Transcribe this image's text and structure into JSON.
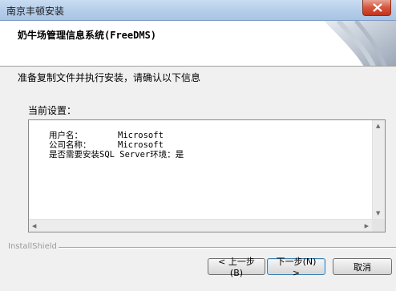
{
  "window": {
    "title": "南京丰顿安装"
  },
  "banner": {
    "title": "奶牛场管理信息系统(FreeDMS)"
  },
  "body": {
    "instruction": "准备复制文件并执行安装，请确认以下信息",
    "current_settings_label": "当前设置：",
    "settings": [
      {
        "key": "用户名：",
        "value": "Microsoft"
      },
      {
        "key": "公司名称：",
        "value": "Microsoft"
      },
      {
        "key": "是否需要安装SQL Server环境：",
        "value": "是"
      }
    ]
  },
  "footer": {
    "brand": "InstallShield",
    "back_label": "< 上一步(B)",
    "next_label": "下一步(N) >",
    "cancel_label": "取消"
  },
  "colors": {
    "titlebar": "#b4cde9",
    "close_button": "#d5553c",
    "default_button_border": "#3c7fb1"
  }
}
